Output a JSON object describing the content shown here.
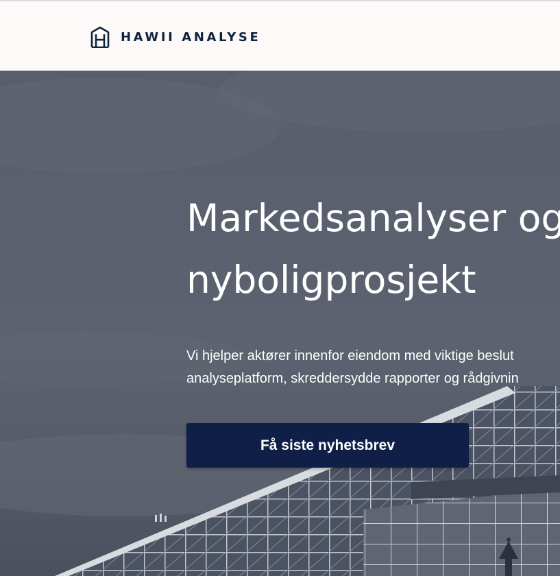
{
  "header": {
    "brand": "HAWII ANALYSE",
    "logo_icon": "house-h-logo-icon"
  },
  "hero": {
    "title_line1": "Markedsanalyser og",
    "title_line2": "nyboligprosjekt",
    "text_line1": "Vi hjelper aktører innenfor eiendom med viktige beslut",
    "text_line2": "analyseplatform, skreddersydde rapporter og rådgivnin",
    "cta_label": "Få siste nyhetsbrev",
    "background_image": "glass-building-photo"
  },
  "colors": {
    "brand": "#0f2340",
    "cta_background": "#0f1f47",
    "header_background": "#fdf9f9",
    "hero_overlay": "#5a606d"
  }
}
